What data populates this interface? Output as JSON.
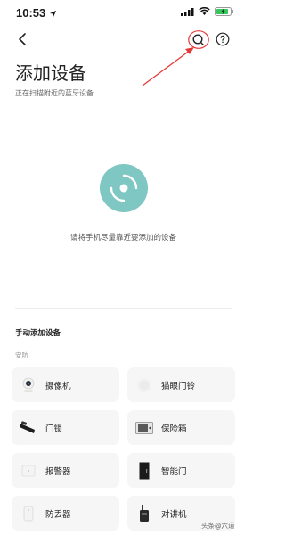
{
  "status_bar": {
    "time": "10:53",
    "location_icon": "location-arrow-icon",
    "signal_icon": "signal-icon",
    "wifi_icon": "wifi-icon",
    "battery_icon": "battery-charging-icon"
  },
  "nav": {
    "back_icon": "chevron-left-icon",
    "search_icon": "search-icon",
    "help_icon": "help-icon",
    "annotation_color": "#e53935"
  },
  "header": {
    "title": "添加设备",
    "subtitle": "正在扫描附近的蓝牙设备..."
  },
  "scan": {
    "hint": "请将手机尽量靠近要添加的设备",
    "accent": "#7fc7c3"
  },
  "manual": {
    "section_title": "手动添加设备",
    "category": "安防",
    "devices": [
      {
        "label": "摄像机",
        "icon": "camera-icon"
      },
      {
        "label": "猫眼门铃",
        "icon": "peephole-doorbell-icon"
      },
      {
        "label": "门锁",
        "icon": "door-lock-icon"
      },
      {
        "label": "保险箱",
        "icon": "safe-icon"
      },
      {
        "label": "报警器",
        "icon": "alarm-icon"
      },
      {
        "label": "智能门",
        "icon": "smart-door-icon"
      },
      {
        "label": "防丢器",
        "icon": "tracker-icon"
      },
      {
        "label": "对讲机",
        "icon": "walkie-talkie-icon"
      }
    ]
  },
  "watermark": "头条@六道"
}
